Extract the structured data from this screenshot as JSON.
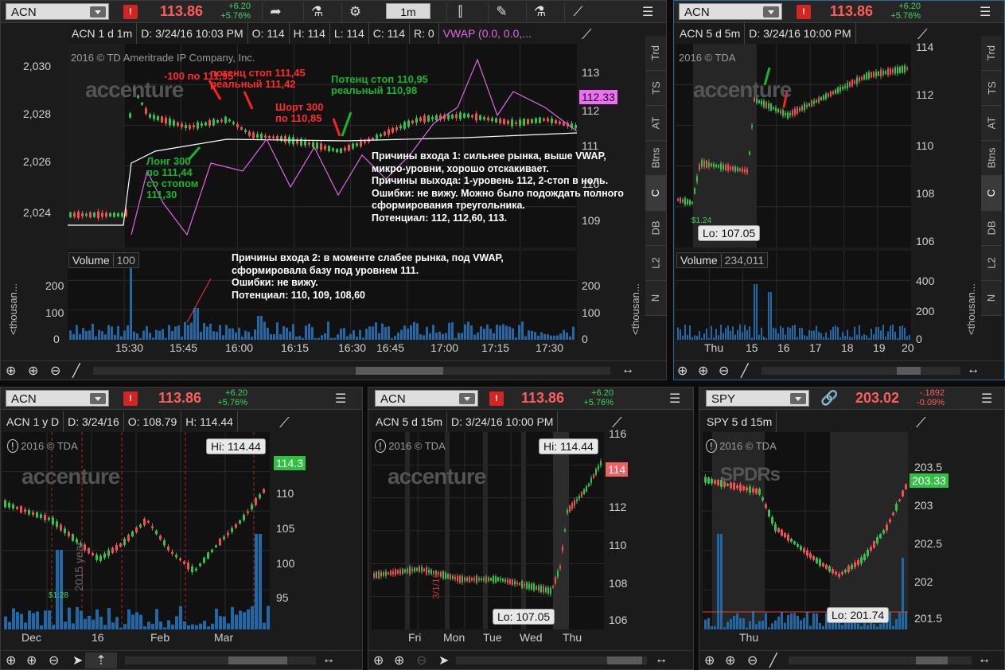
{
  "global": {
    "brand": "accenture",
    "copyright_tda": "2016 © TDA",
    "copyright_full": "2016 © TD Ameritrade IP Company, Inc."
  },
  "colors": {
    "bg": "#0b0b0b",
    "panel": "#1b1b1b",
    "grid": "#2a2a2a",
    "up": "#35c24a",
    "down": "#ef5050",
    "vwap": "#e264e8",
    "volume": "#1e6aa8",
    "red_price": "#ff5c5c",
    "green_change": "#3fd35b"
  },
  "panels": {
    "p1": {
      "symbol": "ACN",
      "price": "113.86",
      "chg1": "+6.20",
      "chg2": "+5.76%",
      "interval": "1m",
      "header_fields": [
        "ACN 1 d 1m",
        "D: 3/24/16 10:03 PM",
        "O: 114",
        "H: 114",
        "L: 114",
        "C: 114",
        "R: 0"
      ],
      "vwap_label": "VWAP (0.0, 0.0,...",
      "price_tag": "112.33",
      "left_ticks": [
        "2,030",
        "2,028",
        "2,026",
        "2,024"
      ],
      "right_ticks": [
        "113",
        "112",
        "111",
        "110",
        "109"
      ],
      "volume_title": "Volume",
      "volume_value": "100",
      "vol_left_ticks": [
        "200",
        "100",
        "0"
      ],
      "vol_right_ticks": [
        "200",
        "100",
        "0"
      ],
      "vol_side_label": "<thousan...",
      "time_ticks": [
        "15:30",
        "15:45",
        "16:00",
        "16:15",
        "16:30",
        "16:45",
        "17:00",
        "17:15",
        "17:30"
      ],
      "side_tabs": [
        "Trd",
        "TS",
        "AT",
        "Btns",
        "C",
        "DB",
        "L2",
        "N"
      ],
      "annotations": {
        "a1": "-100 по 111,95",
        "a2": "потенц стоп 111,45",
        "a3": "реальный 111,42",
        "a4": "Потенц стоп 110,95",
        "a5": "реальный 110,98",
        "a6": "Шорт 300",
        "a7": "по 110,85",
        "a8": "Лонг 300",
        "a9": "по 111,44",
        "a10": "со стопом",
        "a11": "111,30"
      },
      "note1": [
        "Причины входа 1: сильнее рынка, выше VWAP,",
        "микро-уровни, хорошо отскакивает.",
        "Причины выхода: 1-уровень 112, 2-стоп в ноль.",
        "Ошибки: не вижу. Можно было подождать полного",
        "сформирования треугольника.",
        "Потенциал: 112, 112,60, 113."
      ],
      "note2": [
        "Причины входа 2: в моменте слабее рынка, под VWAP,",
        "сформировала базу под уровнем 111.",
        "Ошибки: не вижу.",
        "Потенциал: 110, 109, 108,60"
      ]
    },
    "p2": {
      "symbol": "ACN",
      "price": "113.86",
      "chg1": "+6.20",
      "chg2": "+5.76%",
      "header": "ACN 5 d 5m",
      "date": "D: 3/24/16 10:00 PM",
      "right_ticks": [
        "114",
        "112",
        "110",
        "108",
        "106"
      ],
      "lo_label": "Lo: 107.05",
      "small_label": "$1.24",
      "volume_title": "Volume",
      "volume_value": "234,011",
      "vol_ticks": [
        "400",
        "200",
        "0"
      ],
      "vol_side_label": "<thousan...",
      "time_ticks": [
        "Thu",
        "15",
        "16",
        "17",
        "18",
        "19",
        "20"
      ],
      "side_tabs": [
        "Trd",
        "TS",
        "AT",
        "Btns",
        "C",
        "DB",
        "L2",
        "N"
      ]
    },
    "p3": {
      "symbol": "ACN",
      "price": "113.86",
      "chg1": "+6.20",
      "chg2": "+5.76%",
      "header_fields": [
        "ACN 1 y D",
        "D: 3/24/16",
        "O: 108.79",
        "H: 114.44"
      ],
      "hi_label": "Hi: 114.44",
      "price_tag": "114.3",
      "right_ticks": [
        "110",
        "105",
        "100",
        "95"
      ],
      "year_label": "2015 year",
      "small_label": "$1.28",
      "time_ticks": [
        "Dec",
        "16",
        "Feb",
        "Mar"
      ]
    },
    "p4": {
      "symbol": "ACN",
      "price": "113.86",
      "chg1": "+6.20",
      "chg2": "+5.76%",
      "header": "ACN 5 d 15m",
      "date": "D: 3/24/16 10:00 PM",
      "hi_label": "Hi: 114.44",
      "lo_label": "Lo: 107.05",
      "price_tag": "114",
      "right_ticks": [
        "116",
        "114",
        "112",
        "110",
        "108",
        "106"
      ],
      "date_label": "3/1/16",
      "time_ticks": [
        "Fri",
        "Mon",
        "Tue",
        "Wed",
        "Thu"
      ]
    },
    "p5": {
      "symbol": "SPY",
      "price": "203.02",
      "chg1": "-.1892",
      "chg2": "-0.09%",
      "header": "SPY 5 d 15m",
      "brand": "SPDRs",
      "lo_label": "Lo: 201.74",
      "price_tag": "203.33",
      "right_ticks": [
        "203.5",
        "203",
        "202.5",
        "202",
        "201.5"
      ],
      "time_ticks": [
        "Thu"
      ]
    }
  }
}
